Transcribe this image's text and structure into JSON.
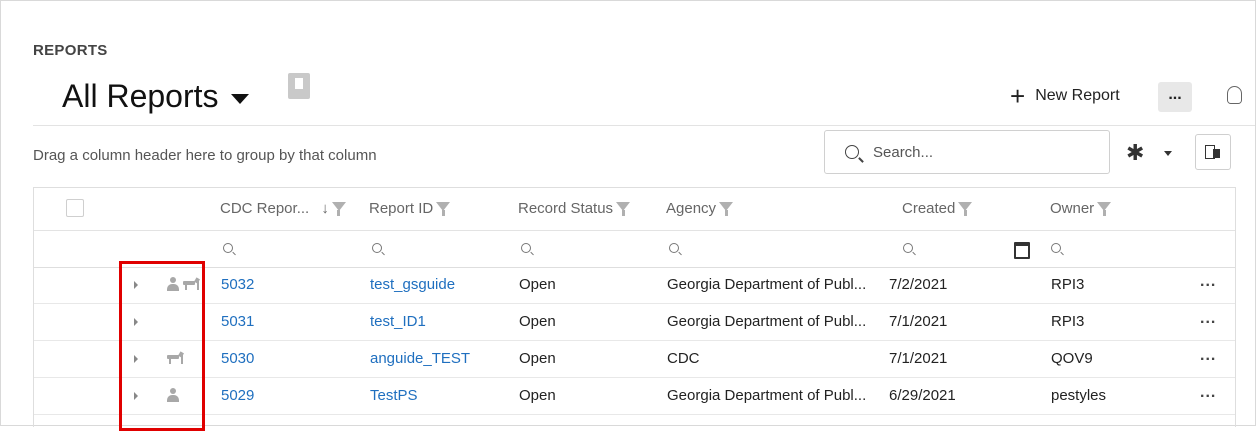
{
  "header": {
    "section_label": "REPORTS",
    "view_title": "All Reports",
    "new_report_label": "New Report",
    "more_label": "..."
  },
  "toolbar": {
    "group_hint": "Drag a column header here to group by that column",
    "search_placeholder": "Search..."
  },
  "table": {
    "columns": [
      {
        "label": "CDC Repor...",
        "sort": "descending",
        "filterable": true
      },
      {
        "label": "Report ID",
        "filterable": true
      },
      {
        "label": "Record Status",
        "filterable": true
      },
      {
        "label": "Agency",
        "filterable": true
      },
      {
        "label": "Created",
        "filterable": true
      },
      {
        "label": "Owner",
        "filterable": true
      }
    ],
    "rows": [
      {
        "cdc": "5032",
        "report_id": "test_gsguide",
        "status": "Open",
        "agency": "Georgia Department of Publ...",
        "created": "7/2/2021",
        "owner": "RPI3",
        "icons": [
          "person-icon",
          "dog-icon"
        ],
        "more": "..."
      },
      {
        "cdc": "5031",
        "report_id": "test_ID1",
        "status": "Open",
        "agency": "Georgia Department of Publ...",
        "created": "7/1/2021",
        "owner": "RPI3",
        "icons": [],
        "more": "..."
      },
      {
        "cdc": "5030",
        "report_id": "anguide_TEST",
        "status": "Open",
        "agency": "CDC",
        "created": "7/1/2021",
        "owner": "QOV9",
        "icons": [
          "dog-icon"
        ],
        "more": "..."
      },
      {
        "cdc": "5029",
        "report_id": "TestPS",
        "status": "Open",
        "agency": "Georgia Department of Publ...",
        "created": "6/29/2021",
        "owner": "pestyles",
        "icons": [
          "person-icon"
        ],
        "more": "..."
      }
    ]
  },
  "colors": {
    "link": "#1f6fbf",
    "highlight_box": "#e00000"
  }
}
